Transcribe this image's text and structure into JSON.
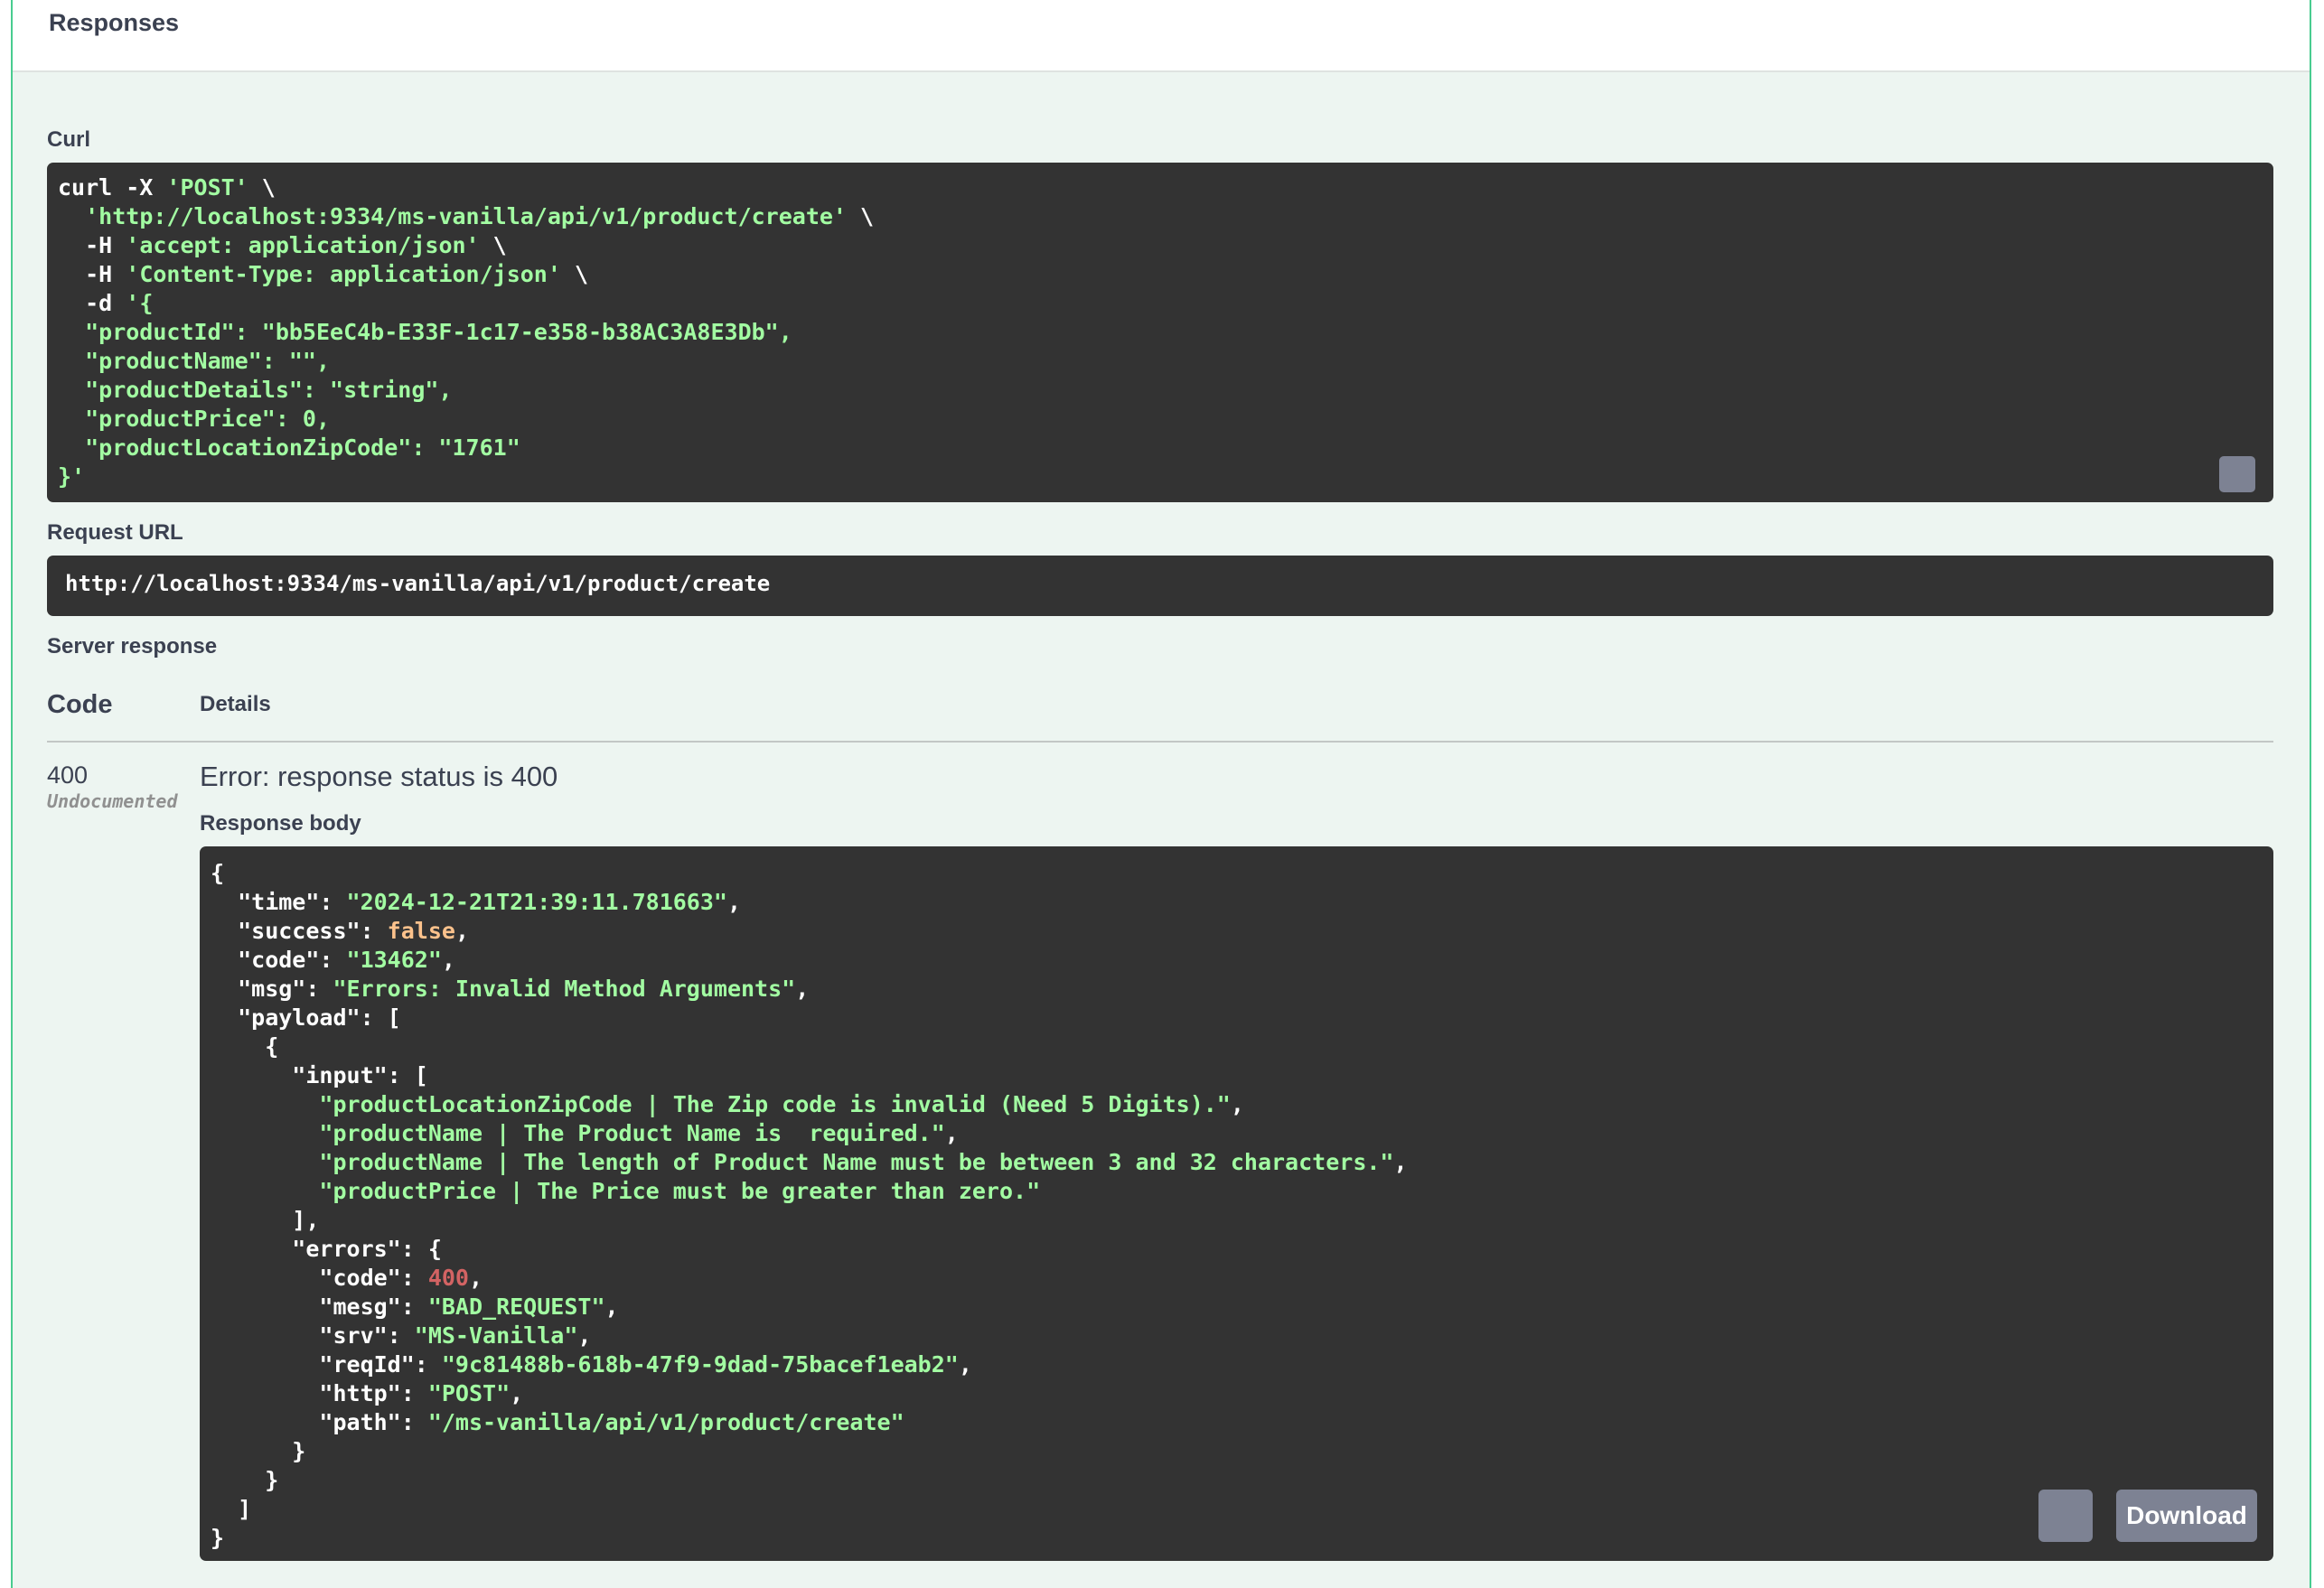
{
  "responses": {
    "title": "Responses"
  },
  "curl": {
    "label": "Curl",
    "lines": [
      [
        "k",
        "curl -X "
      ],
      [
        "s",
        "'POST'"
      ],
      [
        "k",
        " \\\n  "
      ],
      [
        "s",
        "'http://localhost:9334/ms-vanilla/api/v1/product/create'"
      ],
      [
        "k",
        " \\\n  -H "
      ],
      [
        "s",
        "'accept: application/json'"
      ],
      [
        "k",
        " \\\n  -H "
      ],
      [
        "s",
        "'Content-Type: application/json'"
      ],
      [
        "k",
        " \\\n  -d "
      ],
      [
        "s",
        "'{\n  \"productId\": \"bb5EeC4b-E33F-1c17-e358-b38AC3A8E3Db\",\n  \"productName\": \"\",\n  \"productDetails\": \"string\",\n  \"productPrice\": 0,\n  \"productLocationZipCode\": \"1761\"\n}'"
      ]
    ]
  },
  "request_url": {
    "label": "Request URL",
    "value": "http://localhost:9334/ms-vanilla/api/v1/product/create"
  },
  "server_response": {
    "label": "Server response",
    "col_code": "Code",
    "col_details": "Details",
    "code": "400",
    "code_note": "Undocumented",
    "error_text": "Error: response status is 400",
    "body_label": "Response body",
    "download_label": "Download",
    "body": [
      [
        "k",
        "{\n  \"time\": "
      ],
      [
        "s",
        "\"2024-12-21T21:39:11.781663\""
      ],
      [
        "k",
        ",\n  \"success\": "
      ],
      [
        "b",
        "false"
      ],
      [
        "k",
        ",\n  \"code\": "
      ],
      [
        "s",
        "\"13462\""
      ],
      [
        "k",
        ",\n  \"msg\": "
      ],
      [
        "s",
        "\"Errors: Invalid Method Arguments\""
      ],
      [
        "k",
        ",\n  \"payload\": [\n    {\n      \"input\": [\n        "
      ],
      [
        "s",
        "\"productLocationZipCode | The Zip code is invalid (Need 5 Digits).\""
      ],
      [
        "k",
        ",\n        "
      ],
      [
        "s",
        "\"productName | The Product Name is  required.\""
      ],
      [
        "k",
        ",\n        "
      ],
      [
        "s",
        "\"productName | The length of Product Name must be between 3 and 32 characters.\""
      ],
      [
        "k",
        ",\n        "
      ],
      [
        "s",
        "\"productPrice | The Price must be greater than zero.\""
      ],
      [
        "k",
        "\n      ],\n      \"errors\": {\n        \"code\": "
      ],
      [
        "n",
        "400"
      ],
      [
        "k",
        ",\n        \"mesg\": "
      ],
      [
        "s",
        "\"BAD_REQUEST\""
      ],
      [
        "k",
        ",\n        \"srv\": "
      ],
      [
        "s",
        "\"MS-Vanilla\""
      ],
      [
        "k",
        ",\n        \"reqId\": "
      ],
      [
        "s",
        "\"9c81488b-618b-47f9-9dad-75bacef1eab2\""
      ],
      [
        "k",
        ",\n        \"http\": "
      ],
      [
        "s",
        "\"POST\""
      ],
      [
        "k",
        ",\n        \"path\": "
      ],
      [
        "s",
        "\"/ms-vanilla/api/v1/product/create\""
      ],
      [
        "k",
        "\n      }\n    }\n  ]\n}"
      ]
    ]
  },
  "colors": {
    "accent": "#49cc90",
    "code_bg": "#333333",
    "string": "#a2fca2",
    "boolean": "#fcc28c",
    "number": "#d36363",
    "button": "#7d8293"
  },
  "icons": [
    "copy-icon"
  ]
}
